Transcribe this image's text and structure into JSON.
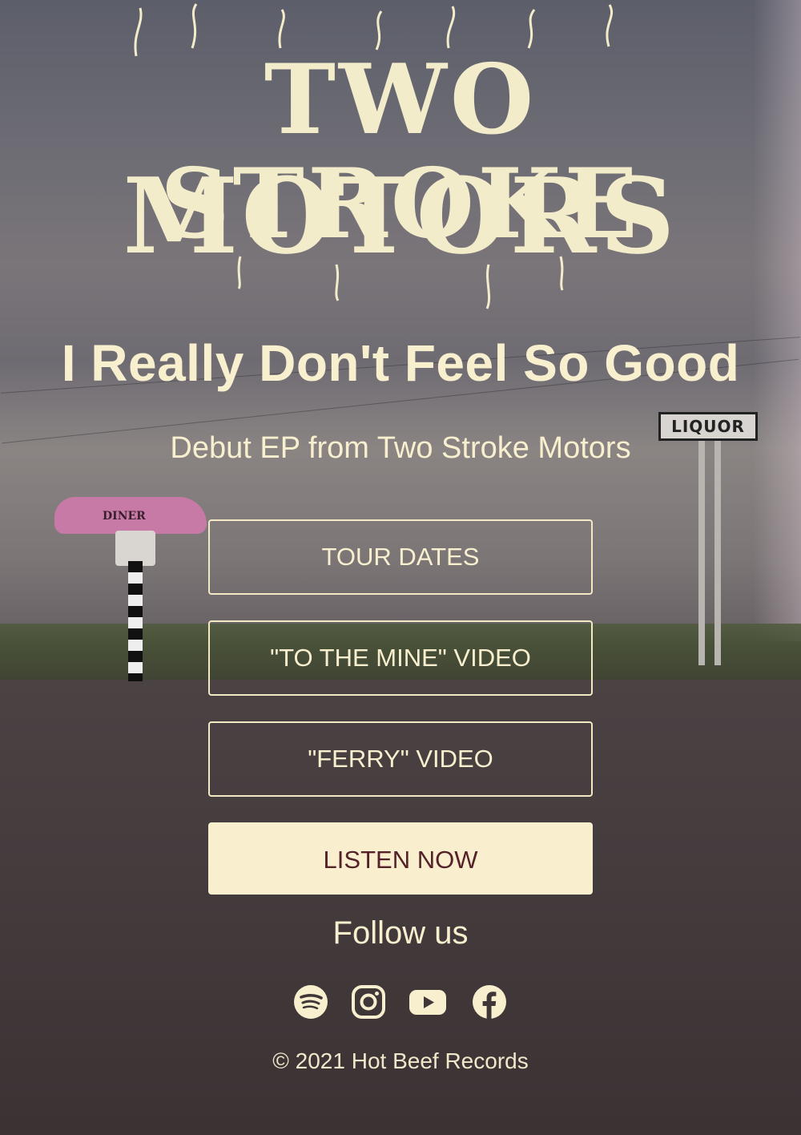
{
  "logo": {
    "line1": "TWO STROKE",
    "line2": "MOTORS"
  },
  "title": "I Really Don't Feel So Good",
  "subtitle": "Debut EP from Two Stroke Motors",
  "scenery": {
    "diner_sign": "DINER",
    "liquor_sign": "LIQUOR"
  },
  "buttons": {
    "tour_dates": "TOUR DATES",
    "to_the_mine": "\"TO THE MINE\" VIDEO",
    "ferry": "\"FERRY\" VIDEO",
    "listen_now": "LISTEN NOW"
  },
  "follow_heading": "Follow us",
  "social": {
    "icons": [
      "spotify-icon",
      "instagram-icon",
      "youtube-icon",
      "facebook-icon"
    ],
    "color": "#f8efcf"
  },
  "footer": "© 2021 Hot Beef Records",
  "colors": {
    "cream": "#f8efcf",
    "button_text_solid": "#55222a"
  }
}
